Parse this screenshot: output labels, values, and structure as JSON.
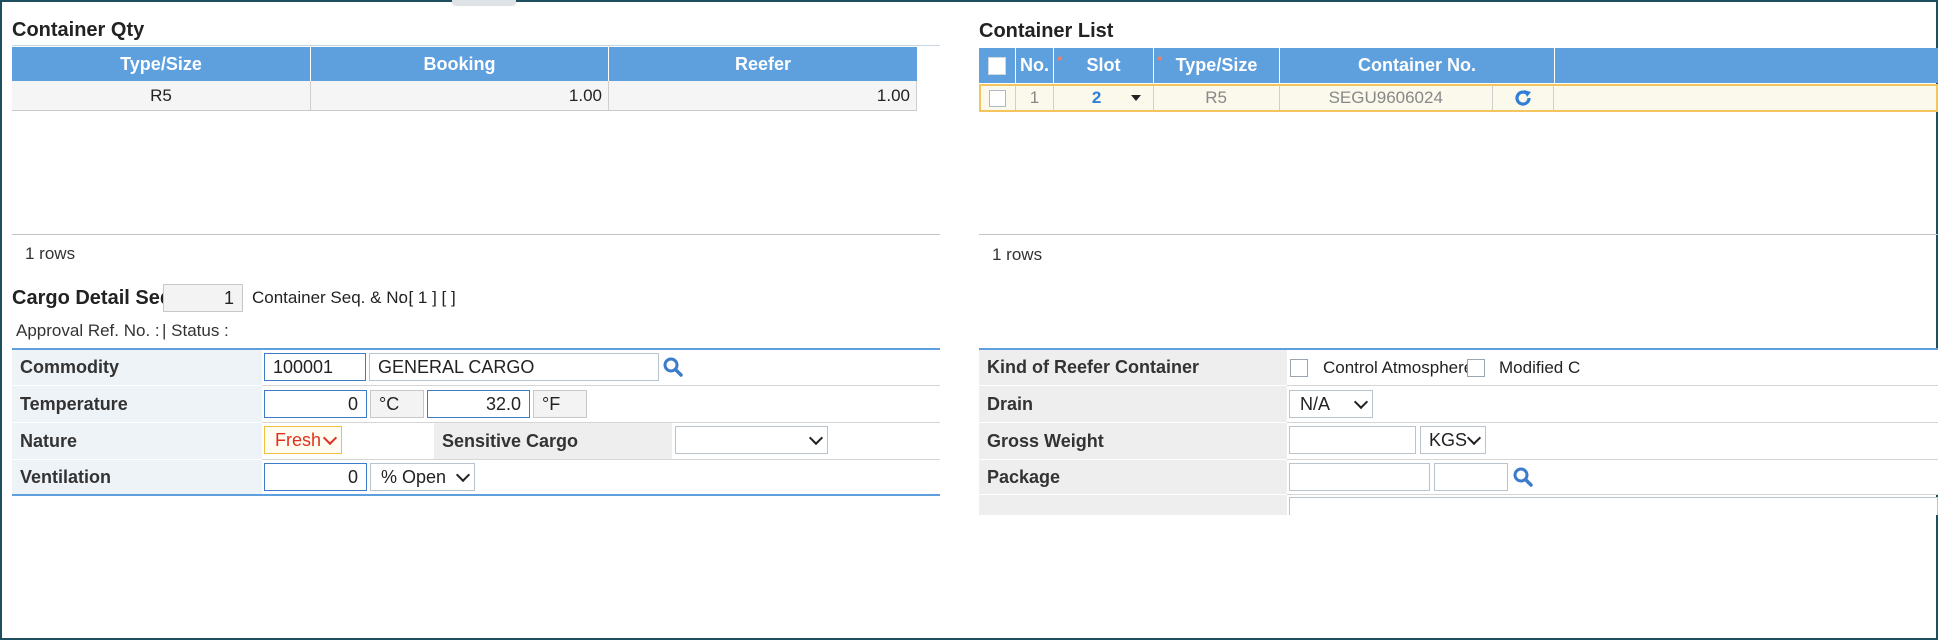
{
  "container_qty": {
    "title": "Container Qty",
    "columns": [
      "Type/Size",
      "Booking",
      "Reefer"
    ],
    "rows": [
      {
        "type_size": "R5",
        "booking": "1.00",
        "reefer": "1.00"
      }
    ],
    "rows_count": "1 rows"
  },
  "container_list": {
    "title": "Container List",
    "columns": [
      "No.",
      "Slot",
      "Type/Size",
      "Container No."
    ],
    "rows": [
      {
        "no": "1",
        "slot": "2",
        "type_size": "R5",
        "container_no": "SEGU9606024"
      }
    ],
    "rows_count": "1 rows",
    "required_marker": "*"
  },
  "cargo_detail": {
    "title": "Cargo Detail Seq.",
    "seq_value": "1",
    "container_seq_label": "Container Seq. & No.",
    "container_seq_value": ": [ 1 ] [ ]",
    "approval_ref_label": "Approval Ref. No. :",
    "status_label": "|  Status  :"
  },
  "form": {
    "commodity": {
      "label": "Commodity",
      "code": "100001",
      "name": "GENERAL CARGO"
    },
    "temperature": {
      "label": "Temperature",
      "celsius": "0",
      "celsius_unit": "°C",
      "fahrenheit": "32.0",
      "fahrenheit_unit": "°F"
    },
    "nature": {
      "label": "Nature",
      "value": "Fresh",
      "value_color": "#e0301e"
    },
    "sensitive_cargo": {
      "label": "Sensitive Cargo",
      "value": ""
    },
    "ventilation": {
      "label": "Ventilation",
      "value": "0",
      "unit": "% Open"
    },
    "kind_of_reefer": {
      "label": "Kind of Reefer Container",
      "option1": "Control Atmosphere",
      "option2": "Modified C"
    },
    "drain": {
      "label": "Drain",
      "value": "N/A"
    },
    "gross_weight": {
      "label": "Gross Weight",
      "value": "",
      "unit": "KGS"
    },
    "package": {
      "label": "Package",
      "value": "",
      "unit": ""
    }
  },
  "colors": {
    "grid_header": "#5e9fde",
    "selected_row_border": "#f3c55c",
    "accent_blue": "#2f7fd8",
    "frame": "#1d4f5f"
  },
  "icons": {
    "search": "search-icon",
    "refresh": "refresh-icon",
    "dropdown": "chevron-down-icon"
  }
}
